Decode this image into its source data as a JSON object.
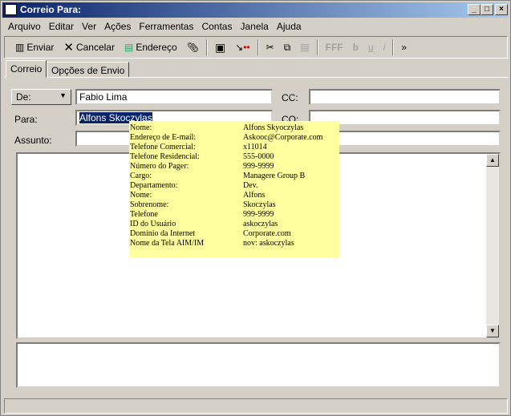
{
  "window": {
    "title": "Correio Para:"
  },
  "menu": [
    "Arquivo",
    "Editar",
    "Ver",
    "Ações",
    "Ferramentas",
    "Contas",
    "Janela",
    "Ajuda"
  ],
  "toolbar": {
    "send": "Enviar",
    "cancel": "Cancelar",
    "address": "Endereço"
  },
  "tabs": [
    "Correio",
    "Opções de Envio"
  ],
  "form": {
    "from_button": "De:",
    "from_value": "Fabio Lima",
    "to_label": "Para:",
    "to_value": "Alfons Skoczylas",
    "cc_label": "CC:",
    "co_label": "CO:",
    "subject_label": "Assunto:",
    "subject_value": ""
  },
  "tooltip": [
    [
      "Nome:",
      "Alfons Skyoczylas"
    ],
    [
      "Endereço de E-mail:",
      "Askooc@Corporate.com"
    ],
    [
      "Telefone Comercial:",
      "x11014"
    ],
    [
      "Telefone Residencial:",
      "555-0000"
    ],
    [
      "Número do Pager:",
      "999-9999"
    ],
    [
      "Cargo:",
      "Managere Group B"
    ],
    [
      "Departamento:",
      "Dev."
    ],
    [
      "Nome:",
      "Alfons"
    ],
    [
      "Sobrenome:",
      "Skoczylas"
    ],
    [
      "Telefone",
      "999-9999"
    ],
    [
      "ID do Usuário",
      "askoczylas"
    ],
    [
      "Domínio da Internet",
      "Corporate.com"
    ],
    [
      "Nome da Tela AIM/IM",
      "nov: askoczylas"
    ]
  ]
}
